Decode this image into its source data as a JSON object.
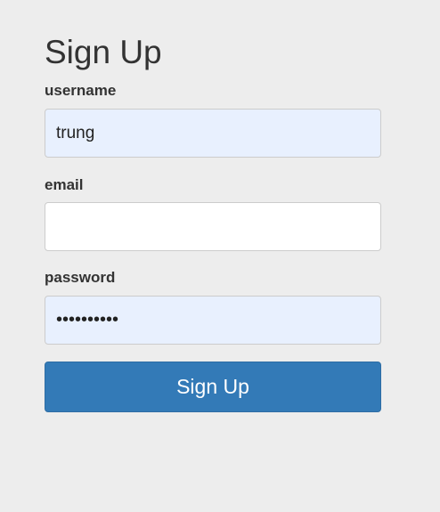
{
  "page": {
    "title": "Sign Up"
  },
  "form": {
    "username": {
      "label": "username",
      "value": "trung"
    },
    "email": {
      "label": "email",
      "value": ""
    },
    "password": {
      "label": "password",
      "masked_value": "••••••••••"
    },
    "submit_label": "Sign Up"
  },
  "colors": {
    "background": "#ededed",
    "autofill_field": "#e8f0fe",
    "button": "#337ab7",
    "button_text": "#ffffff"
  }
}
